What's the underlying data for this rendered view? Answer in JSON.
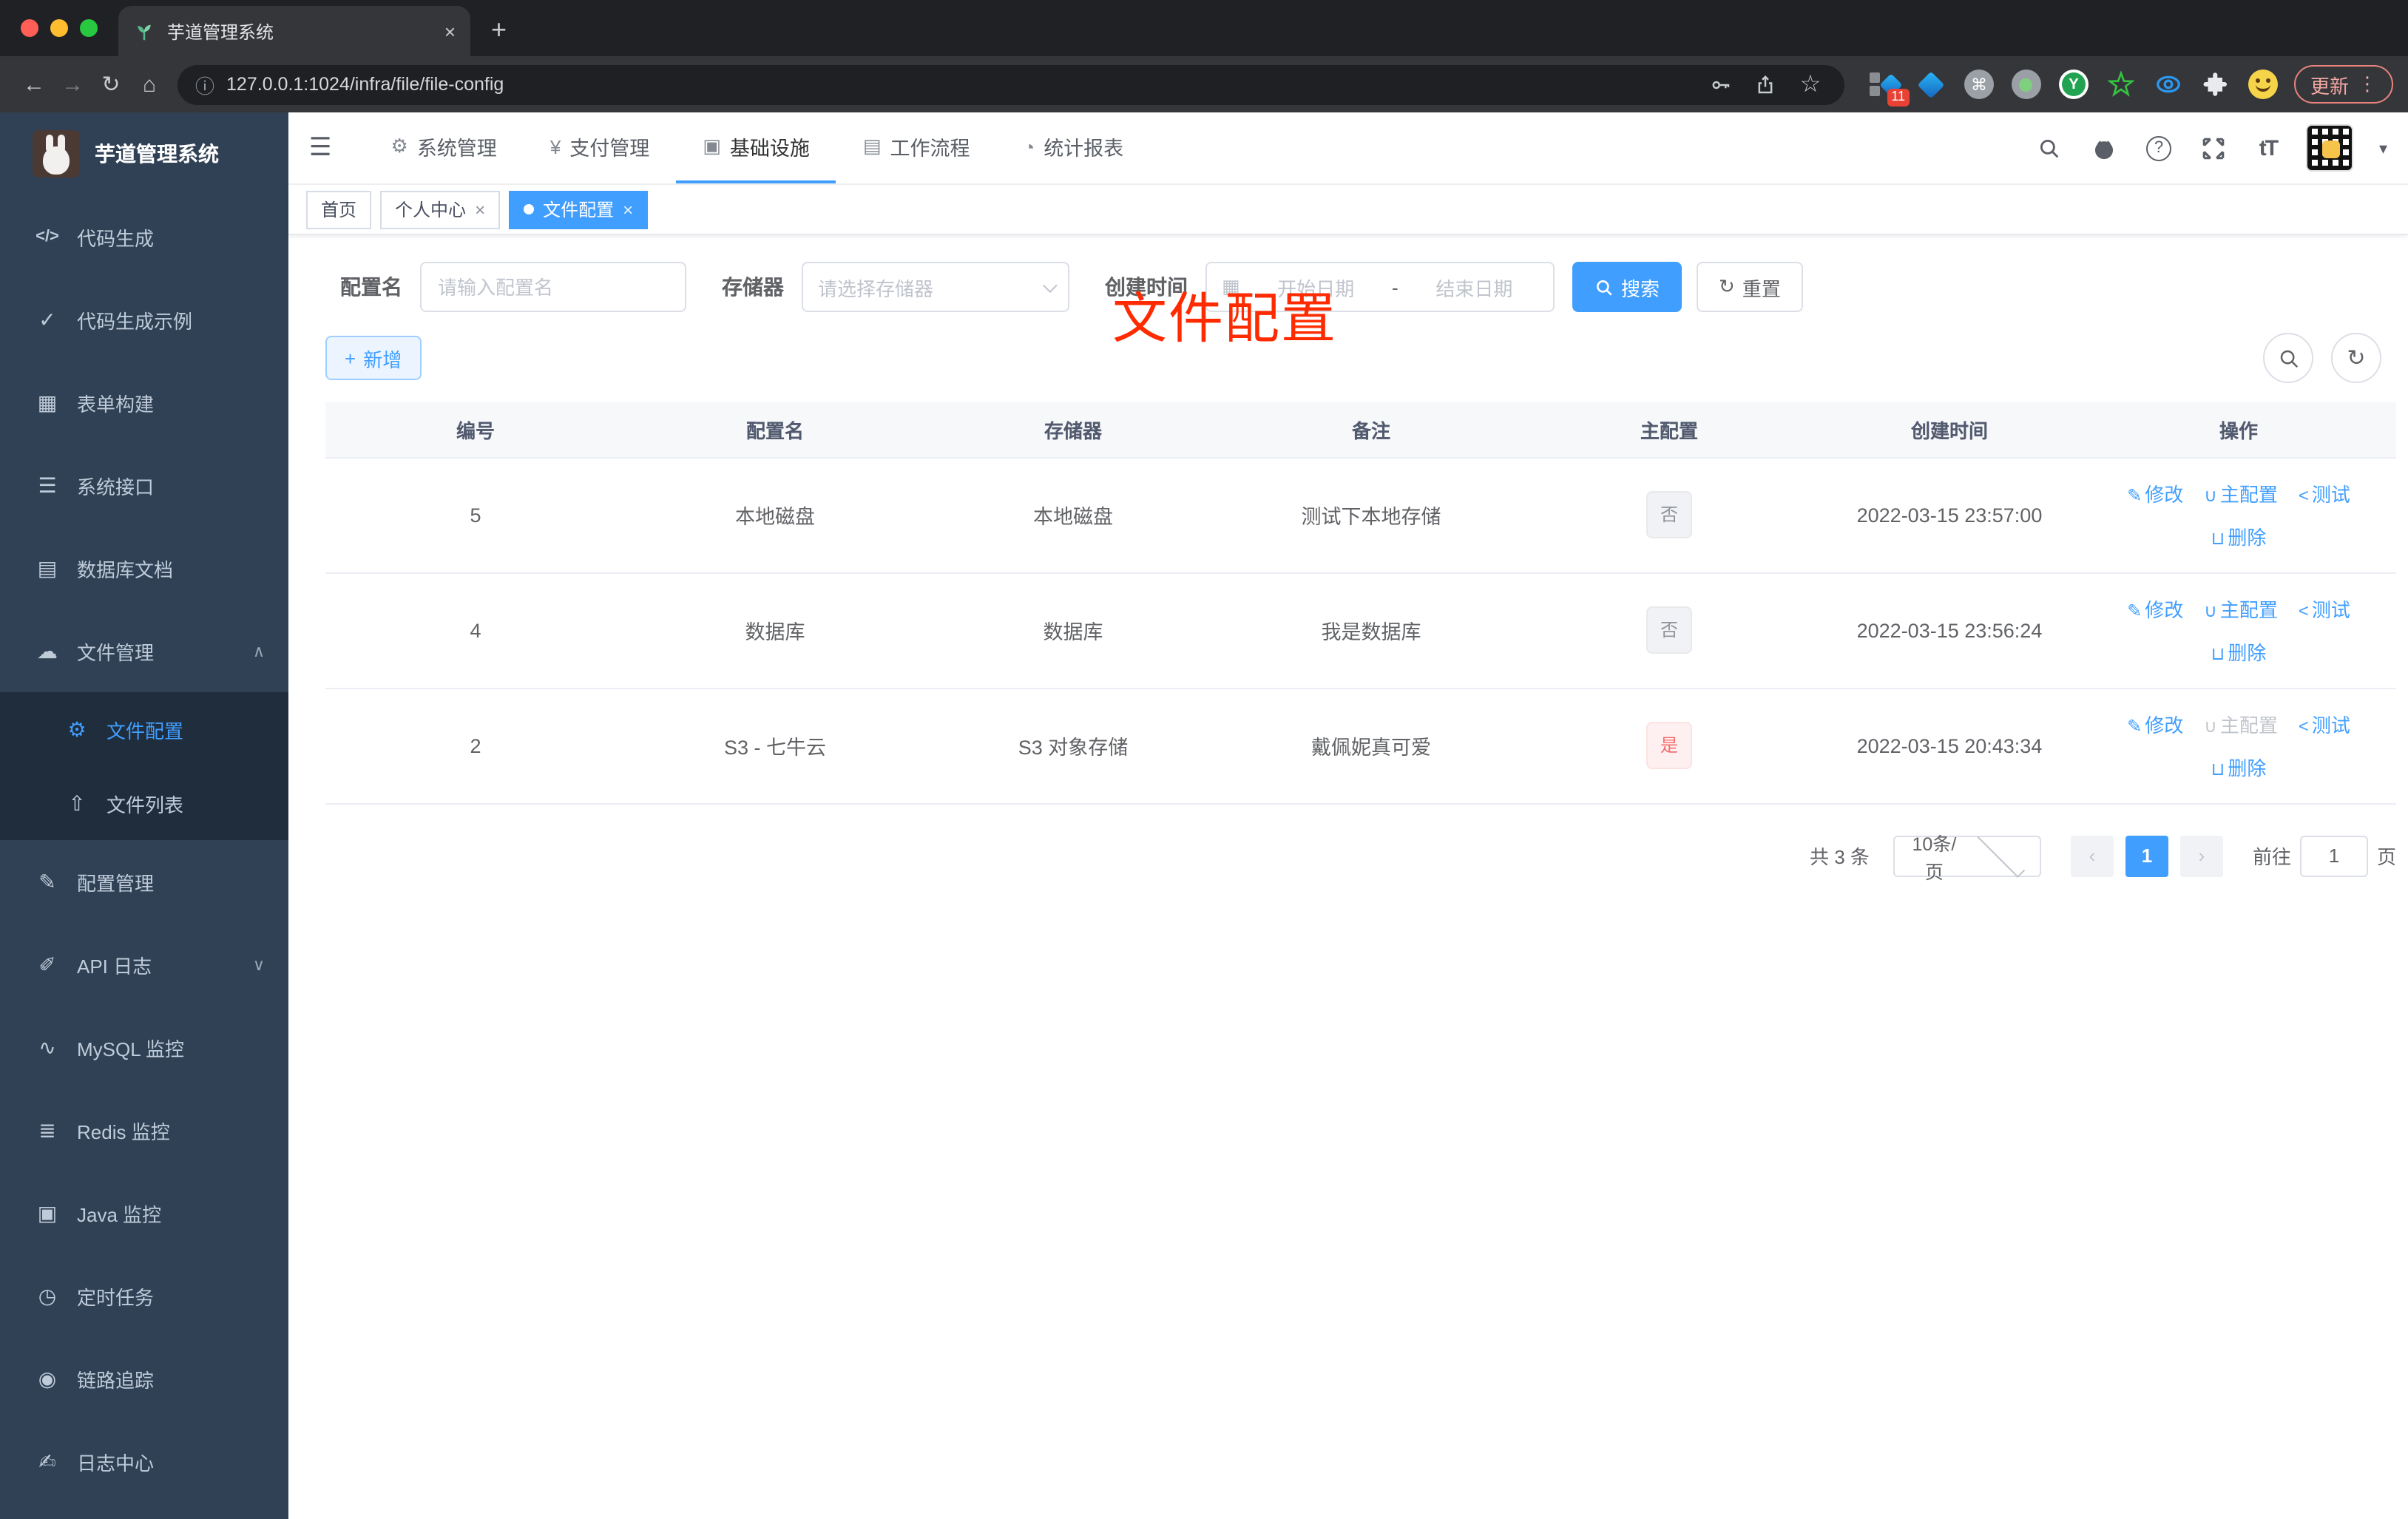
{
  "browser": {
    "tab_title": "芋道管理系统",
    "url": "127.0.0.1:1024/infra/file/file-config",
    "update_label": "更新",
    "extensions_badge": "11"
  },
  "icons": {
    "back": "←",
    "forward": "→",
    "reload": "↻",
    "home": "⌂",
    "info": "ⓘ",
    "star": "☆",
    "new_tab": "+",
    "close_tab": "×",
    "kebab": "⋮",
    "hamburger": "☰",
    "caret_down": "▾",
    "command": "⌘",
    "calendar": "▦",
    "plus": "+",
    "reset": "↻",
    "font_size": "tT",
    "chevron_up": "∧",
    "chevron_down": "∨"
  },
  "sidebar": {
    "app_title": "芋道管理系统",
    "items": [
      {
        "icon": "</>",
        "label": "代码生成"
      },
      {
        "icon": "✓",
        "label": "代码生成示例"
      },
      {
        "icon": "▦",
        "label": "表单构建"
      },
      {
        "icon": "☰",
        "label": "系统接口"
      },
      {
        "icon": "▤",
        "label": "数据库文档"
      },
      {
        "icon": "☁",
        "label": "文件管理",
        "chevron": "∧"
      }
    ],
    "submenu": [
      {
        "icon": "⚙",
        "label": "文件配置"
      },
      {
        "icon": "⇧",
        "label": "文件列表"
      }
    ],
    "items2": [
      {
        "icon": "✎",
        "label": "配置管理"
      },
      {
        "icon": "✐",
        "label": "API 日志",
        "chevron": "∨"
      },
      {
        "icon": "∿",
        "label": "MySQL 监控"
      },
      {
        "icon": "≣",
        "label": "Redis 监控"
      },
      {
        "icon": "▣",
        "label": "Java 监控"
      },
      {
        "icon": "◷",
        "label": "定时任务"
      },
      {
        "icon": "◉",
        "label": "链路追踪"
      },
      {
        "icon": "✍",
        "label": "日志中心"
      }
    ]
  },
  "header": {
    "nav": [
      {
        "icon": "⚙",
        "label": "系统管理"
      },
      {
        "icon": "¥",
        "label": "支付管理"
      },
      {
        "icon": "▣",
        "label": "基础设施"
      },
      {
        "icon": "▤",
        "label": "工作流程"
      },
      {
        "icon": "◔",
        "label": "统计报表"
      }
    ]
  },
  "tabs": {
    "home": "首页",
    "profile": "个人中心",
    "file_config": "文件配置"
  },
  "annotation": {
    "text": "文件配置"
  },
  "filters": {
    "config_name_label": "配置名",
    "config_name_placeholder": "请输入配置名",
    "storage_label": "存储器",
    "storage_placeholder": "请选择存储器",
    "create_time_label": "创建时间",
    "date_start_placeholder": "开始日期",
    "date_separator": "-",
    "date_end_placeholder": "结束日期",
    "search_label": "搜索",
    "reset_label": "重置"
  },
  "toolbar": {
    "add_label": "新增"
  },
  "table": {
    "headers": [
      "编号",
      "配置名",
      "存储器",
      "备注",
      "主配置",
      "创建时间",
      "操作"
    ],
    "actions": {
      "edit": "修改",
      "master": "主配置",
      "test": "测试",
      "delete": "删除"
    },
    "rows": [
      {
        "id": "5",
        "name": "本地磁盘",
        "storage": "本地磁盘",
        "remark": "测试下本地存储",
        "master": "否",
        "created": "2022-03-15 23:57:00"
      },
      {
        "id": "4",
        "name": "数据库",
        "storage": "数据库",
        "remark": "我是数据库",
        "master": "否",
        "created": "2022-03-15 23:56:24"
      },
      {
        "id": "2",
        "name": "S3 - 七牛云",
        "storage": "S3 对象存储",
        "remark": "戴佩妮真可爱",
        "master": "是",
        "created": "2022-03-15 20:43:34"
      }
    ]
  },
  "pagination": {
    "total": "共 3 条",
    "page_size": "10条/页",
    "prev": "‹",
    "current_page": "1",
    "next": "›",
    "goto_label": "前往",
    "goto_value": "1",
    "page_suffix": "页"
  },
  "colors": {
    "accent": "#409eff",
    "sidebar_bg": "#304156",
    "submenu_bg": "#1f2d3d",
    "annotation_red": "#ff2b00",
    "tag_no_text": "#909399",
    "tag_yes_text": "#f56c6c"
  }
}
